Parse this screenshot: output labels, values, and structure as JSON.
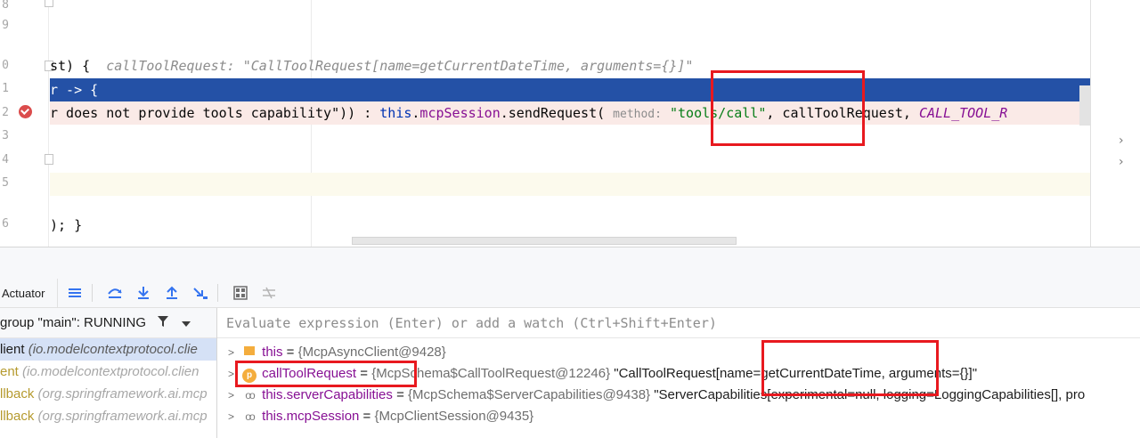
{
  "editor": {
    "line_numbers": [
      "8",
      "9",
      "0",
      "1",
      "2",
      "3",
      "4",
      "5",
      "6"
    ],
    "line0": {
      "code": "st) {",
      "hint": "callToolRequest: \"CallToolRequest[name=getCurrentDateTime, arguments={}]\""
    },
    "line1": {
      "code": "r -> {"
    },
    "line2": {
      "pre": "r does not provide tools capability\")) : ",
      "kw": "this",
      "dot": ".",
      "field": "mcpSession",
      "call": ".sendRequest(",
      "param_hint": "method:",
      "str": "\"tools/call\"",
      "comma": ", callToolRequest, ",
      "const": "CALL_TOOL_R"
    },
    "line6": {
      "code": "); }"
    }
  },
  "toolbar": {
    "tab_label": "Actuator"
  },
  "thread": {
    "label": "group \"main\": RUNNING"
  },
  "frames": [
    {
      "name": "lient",
      "pkg": "(io.modelcontextprotocol.clie"
    },
    {
      "name": "ent",
      "pkg": "(io.modelcontextprotocol.clien"
    },
    {
      "name": "llback",
      "pkg": "(org.springframework.ai.mcp"
    },
    {
      "name": "llback",
      "pkg": "(org.springframework.ai.mcp"
    }
  ],
  "eval": {
    "placeholder": "Evaluate expression (Enter) or add a watch (Ctrl+Shift+Enter)"
  },
  "variables": [
    {
      "name": "this",
      "eq": " = ",
      "type": "{McpAsyncClient@9428}",
      "value": "",
      "icon": "field-icon"
    },
    {
      "name": "callToolRequest",
      "eq": " = ",
      "type": "{McpSchema$CallToolRequest@12246}",
      "value": " \"CallToolRequest[name=getCurrentDateTime, arguments={}]\"",
      "icon": "parameter-icon",
      "badge": "p"
    },
    {
      "name": "this.serverCapabilities",
      "eq": " = ",
      "type": "{McpSchema$ServerCapabilities@9438}",
      "value": " \"ServerCapabilities[experimental=null, logging=LoggingCapabilities[], pro",
      "icon": "watch-icon"
    },
    {
      "name": "this.mcpSession",
      "eq": " = ",
      "type": "{McpClientSession@9435}",
      "value": "",
      "icon": "watch-icon"
    }
  ],
  "colors": {
    "selection": "#2451a6",
    "error_line": "#faeae7",
    "annotation_box": "#e8191f"
  }
}
